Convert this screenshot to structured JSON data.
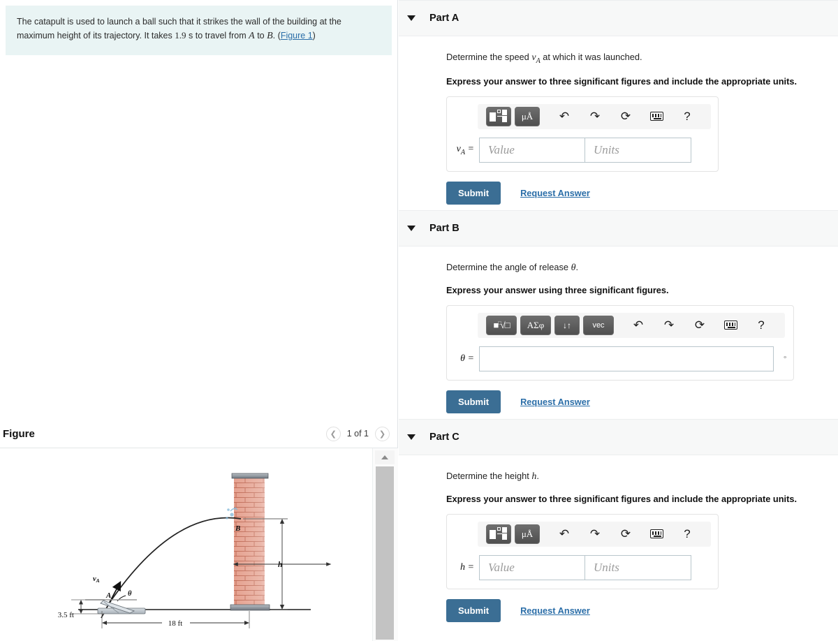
{
  "problem": {
    "text_before_time": "The catapult is used to launch a ball such that it strikes the wall of the building at the maximum height of its trajectory. It takes",
    "time_value": "1.9",
    "time_unit": "s",
    "text_middle": "to travel from",
    "point_a": "A",
    "text_to": "to",
    "point_b": "B",
    "period": ".",
    "figure_link": "Figure 1",
    "paren_open": "(",
    "paren_close": ")"
  },
  "figure": {
    "title": "Figure",
    "prev_icon": "chevron-left-icon",
    "next_icon": "chevron-right-icon",
    "counter": "1 of 1",
    "labels": {
      "point_a": "A",
      "point_b": "B",
      "velocity": "v",
      "velocity_sub": "A",
      "angle": "θ",
      "height": "h",
      "ground_height": "3.5 ft",
      "distance": "18 ft"
    }
  },
  "parts": [
    {
      "id": "part-a",
      "title": "Part A",
      "prompt_before": "Determine the speed",
      "prompt_symbol": "v",
      "prompt_symbol_sub": "A",
      "prompt_after": "at which it was launched.",
      "instruction": "Express your answer to three significant figures and include the appropriate units.",
      "toolbar_type": "units",
      "toolbar_buttons": [
        "template-icon",
        "micro-angstrom-icon"
      ],
      "toolbar_icons": [
        "undo-icon",
        "redo-icon",
        "reset-icon",
        "keyboard-icon",
        "help-icon"
      ],
      "toolbar_labels": {
        "units_button": "μÅ",
        "help": "?"
      },
      "field_label": "v",
      "field_label_sub": "A",
      "field_equals": "=",
      "value_placeholder": "Value",
      "units_placeholder": "Units",
      "value_text": "",
      "units_text": "",
      "submit_label": "Submit",
      "request_label": "Request Answer"
    },
    {
      "id": "part-b",
      "title": "Part B",
      "prompt_before": "Determine the angle of release",
      "prompt_symbol": "θ",
      "prompt_symbol_sub": "",
      "prompt_after": ".",
      "instruction": "Express your answer using three significant figures.",
      "toolbar_type": "math",
      "toolbar_buttons": [
        "nth-root-icon",
        "greek-symbols-icon",
        "updown-arrows-icon",
        "vector-icon"
      ],
      "toolbar_icons": [
        "undo-icon",
        "redo-icon",
        "reset-icon",
        "keyboard-icon",
        "help-icon"
      ],
      "toolbar_labels": {
        "greek_button": "ΑΣφ",
        "arrows_button": "↓↑",
        "vec_button": "vec",
        "help": "?"
      },
      "field_label": "θ",
      "field_label_sub": "",
      "field_equals": "=",
      "value_placeholder": "",
      "units_placeholder": "",
      "value_text": "",
      "unit_suffix": "°",
      "submit_label": "Submit",
      "request_label": "Request Answer"
    },
    {
      "id": "part-c",
      "title": "Part C",
      "prompt_before": "Determine the height",
      "prompt_symbol": "h",
      "prompt_symbol_sub": "",
      "prompt_after": ".",
      "instruction": "Express your answer to three significant figures and include the appropriate units.",
      "toolbar_type": "units",
      "toolbar_buttons": [
        "template-icon",
        "micro-angstrom-icon"
      ],
      "toolbar_icons": [
        "undo-icon",
        "redo-icon",
        "reset-icon",
        "keyboard-icon",
        "help-icon"
      ],
      "toolbar_labels": {
        "units_button": "μÅ",
        "help": "?"
      },
      "field_label": "h",
      "field_label_sub": "",
      "field_equals": "=",
      "value_placeholder": "Value",
      "units_placeholder": "Units",
      "value_text": "",
      "units_text": "",
      "submit_label": "Submit",
      "request_label": "Request Answer"
    }
  ],
  "colors": {
    "banner_bg": "#e9f4f4",
    "submit_bg": "#3b6e94",
    "link": "#2b6ea8",
    "part_header_bg": "#f7f8f8",
    "brick": "#d98b78",
    "toolbar_btn": "#5f5f5f"
  }
}
